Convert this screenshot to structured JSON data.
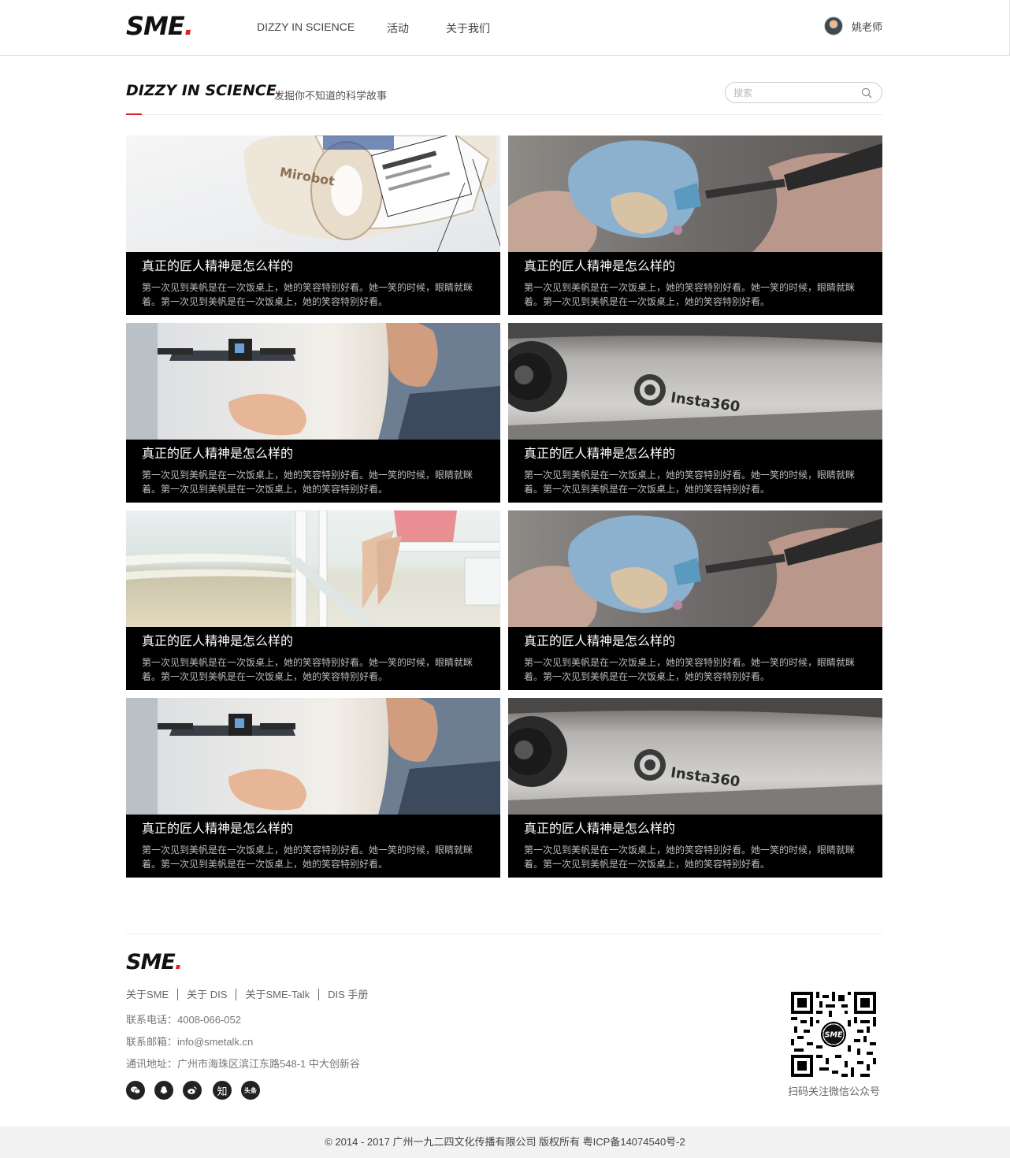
{
  "brand": {
    "logo_text": "SME",
    "logo_dot": "."
  },
  "nav": {
    "items": [
      {
        "label": "DIZZY IN SCIENCE"
      },
      {
        "label": "活动"
      },
      {
        "label": "关于我们"
      }
    ]
  },
  "user": {
    "name": "姚老师"
  },
  "section": {
    "title": "DIZZY IN SCIENCE",
    "title_dot": ".",
    "subtitle": "发掘你不知道的科学故事"
  },
  "search": {
    "placeholder": "搜索"
  },
  "cards": [
    {
      "image": "robot-photo",
      "title": "真正的匠人精神是怎么样的",
      "desc": "第一次见到美帆是在一次饭桌上，她的笑容特别好看。她一笑的时候，眼睛就眯着。第一次见到美帆是在一次饭桌上，她的笑容特别好看。"
    },
    {
      "image": "heart-model-photo",
      "title": "真正的匠人精神是怎么样的",
      "desc": "第一次见到美帆是在一次饭桌上，她的笑容特别好看。她一笑的时候，眼睛就眯着。第一次见到美帆是在一次饭桌上，她的笑容特别好看。"
    },
    {
      "image": "drone-hand-photo",
      "title": "真正的匠人精神是怎么样的",
      "desc": "第一次见到美帆是在一次饭桌上，她的笑容特别好看。她一笑的时候，眼睛就眯着。第一次见到美帆是在一次饭桌上，她的笑容特别好看。"
    },
    {
      "image": "insta360-photo",
      "title": "真正的匠人精神是怎么样的",
      "desc": "第一次见到美帆是在一次饭桌上，她的笑容特别好看。她一笑的时候，眼睛就眯着。第一次见到美帆是在一次饭桌上，她的笑容特别好看。"
    },
    {
      "image": "beach-photo",
      "title": "真正的匠人精神是怎么样的",
      "desc": "第一次见到美帆是在一次饭桌上，她的笑容特别好看。她一笑的时候，眼睛就眯着。第一次见到美帆是在一次饭桌上，她的笑容特别好看。"
    },
    {
      "image": "heart-model-photo",
      "title": "真正的匠人精神是怎么样的",
      "desc": "第一次见到美帆是在一次饭桌上，她的笑容特别好看。她一笑的时候，眼睛就眯着。第一次见到美帆是在一次饭桌上，她的笑容特别好看。"
    },
    {
      "image": "drone-hand-photo",
      "title": "真正的匠人精神是怎么样的",
      "desc": "第一次见到美帆是在一次饭桌上，她的笑容特别好看。她一笑的时候，眼睛就眯着。第一次见到美帆是在一次饭桌上，她的笑容特别好看。"
    },
    {
      "image": "insta360-photo",
      "title": "真正的匠人精神是怎么样的",
      "desc": "第一次见到美帆是在一次饭桌上，她的笑容特别好看。她一笑的时候，眼睛就眯着。第一次见到美帆是在一次饭桌上，她的笑容特别好看。"
    }
  ],
  "image_text": {
    "robot": "Mirobot",
    "camera": "Insta360"
  },
  "footer": {
    "links": [
      "关于SME",
      "关于 DIS",
      "关于SME-Talk",
      "DIS 手册"
    ],
    "phone": "联系电话：4008-066-052",
    "email": "联系邮箱：info@smetalk.cn",
    "address": "通讯地址：广州市海珠区滨江东路548-1 中大创新谷",
    "social": {
      "zhihu": "知",
      "toutiao": "头条"
    },
    "qr_caption": "扫码关注微信公众号",
    "qr_center": "SME",
    "copyright": "© 2014 - 2017 广州一九二四文化传播有限公司   版权所有   粤ICP备14074540号-2"
  },
  "colors": {
    "accent": "#e02020",
    "card_bg": "#000000",
    "footer_bg": "#f2f2f2"
  }
}
